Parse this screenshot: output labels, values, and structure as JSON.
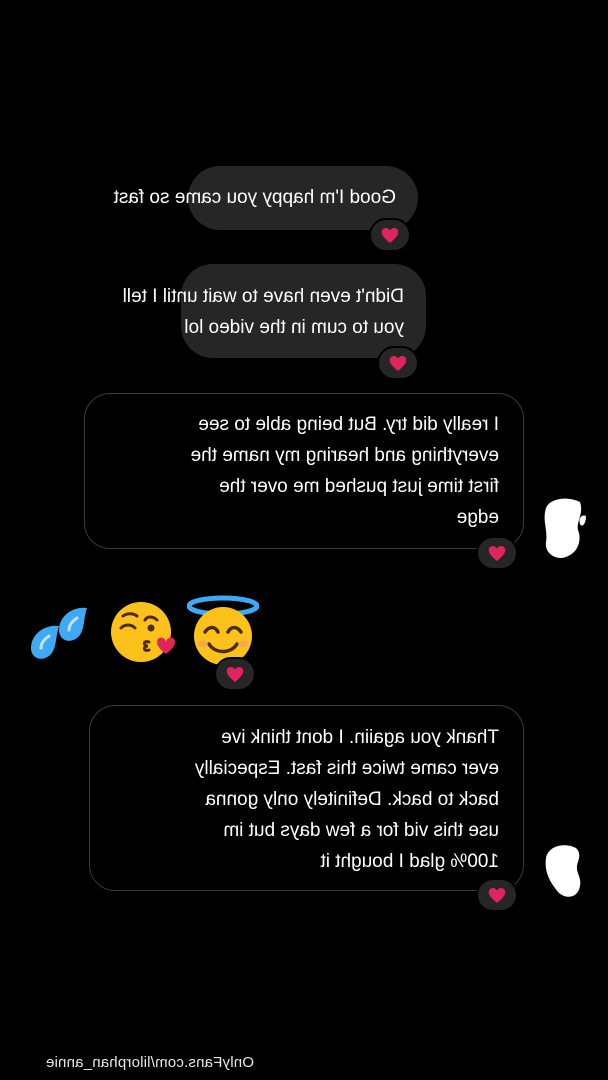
{
  "messages": [
    {
      "side": "received",
      "lines": [
        "Good I'm happy you came so fast"
      ],
      "reaction": "heart-icon"
    },
    {
      "side": "received",
      "lines": [
        "Didn't even have to wait until I tell",
        "you to cum in the video lol"
      ],
      "reaction": "heart-icon"
    },
    {
      "side": "sent",
      "lines": [
        "I really did try. But being able to see",
        "everything and hearing my name the",
        "first time just pushed me over the",
        "edge"
      ],
      "reaction": "heart-icon"
    },
    {
      "side": "sent",
      "emojis": [
        "smiling-face-with-halo-emoji",
        "face-blowing-kiss-emoji",
        "sweat-droplets-emoji"
      ],
      "reaction": "heart-icon"
    },
    {
      "side": "sent",
      "lines": [
        "Thank you agaiin. I dont think ive",
        "ever came twice this fast. Especially",
        "back to back. Definitely only gonna",
        "use this vid for a few days but im",
        "100% glad I bought it"
      ],
      "reaction": "heart-icon"
    }
  ],
  "watermark": "OnlyFans.com/lilorphan_annie",
  "colors": {
    "background": "#000000",
    "received_bubble": "#262626",
    "sent_border": "#3a3a3a",
    "heart": "#e0245e"
  }
}
